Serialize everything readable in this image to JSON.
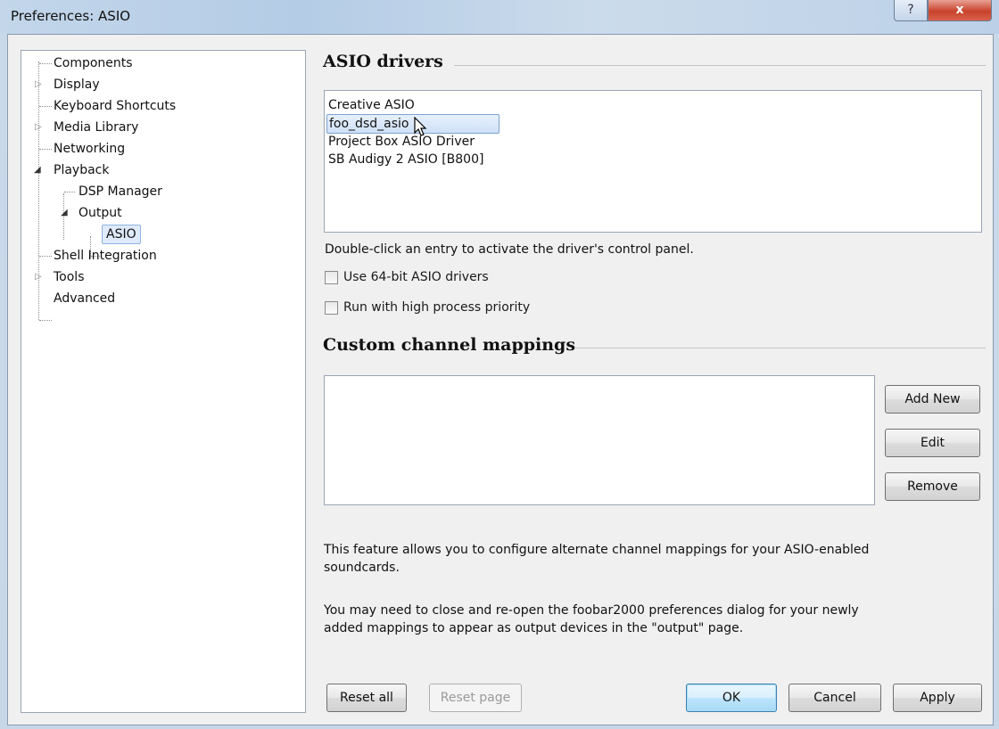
{
  "window": {
    "title": "Preferences: ASIO",
    "help_label": "?",
    "close_label": "x"
  },
  "tree": {
    "items": [
      {
        "label": "Components",
        "expander": ""
      },
      {
        "label": "Display",
        "expander": "▷"
      },
      {
        "label": "Keyboard Shortcuts",
        "expander": ""
      },
      {
        "label": "Media Library",
        "expander": "▷"
      },
      {
        "label": "Networking",
        "expander": ""
      },
      {
        "label": "Playback",
        "expander": "◢"
      },
      {
        "label": "DSP Manager",
        "expander": ""
      },
      {
        "label": "Output",
        "expander": "◢"
      },
      {
        "label": "ASIO",
        "expander": ""
      },
      {
        "label": "Shell Integration",
        "expander": ""
      },
      {
        "label": "Tools",
        "expander": "▷"
      },
      {
        "label": "Advanced",
        "expander": ""
      }
    ],
    "selected": "ASIO"
  },
  "asio": {
    "title": "ASIO drivers",
    "drivers": [
      "Creative ASIO",
      "foo_dsd_asio",
      "Project Box ASIO Driver",
      "SB Audigy 2 ASIO [B800]"
    ],
    "selected_driver": "foo_dsd_asio",
    "hint": "Double-click an entry to activate the driver's control panel.",
    "use_64bit_label": "Use 64-bit ASIO drivers",
    "use_64bit_checked": false,
    "high_priority_label": "Run with high process priority",
    "high_priority_checked": false
  },
  "mappings": {
    "title": "Custom channel mappings",
    "add_new": "Add New",
    "edit": "Edit",
    "remove": "Remove",
    "info1": "This feature allows you to configure alternate channel mappings for your ASIO-enabled soundcards.",
    "info2": "You may need to close and re-open the foobar2000 preferences dialog for your newly added mappings to appear as output devices in the \"output\" page."
  },
  "footer": {
    "reset_all": "Reset all",
    "reset_page": "Reset page",
    "ok": "OK",
    "cancel": "Cancel",
    "apply": "Apply"
  }
}
